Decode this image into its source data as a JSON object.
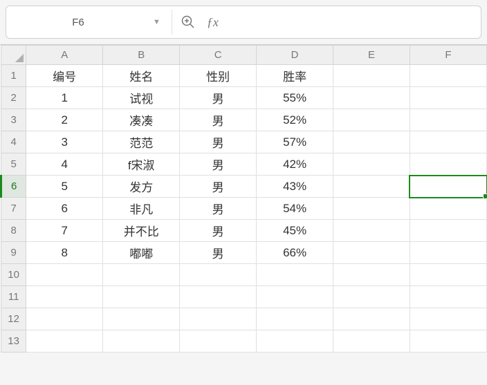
{
  "formula_bar": {
    "cell_reference": "F6",
    "formula_value": ""
  },
  "columns": [
    "A",
    "B",
    "C",
    "D",
    "E",
    "F"
  ],
  "row_numbers": [
    "1",
    "2",
    "3",
    "4",
    "5",
    "6",
    "7",
    "8",
    "9",
    "10",
    "11",
    "12",
    "13"
  ],
  "active_row": 6,
  "selected_cell": {
    "row": 6,
    "col": "F"
  },
  "chart_data": {
    "type": "table",
    "headers": [
      "编号",
      "姓名",
      "性别",
      "胜率"
    ],
    "rows": [
      [
        "1",
        "试视",
        "男",
        "55%"
      ],
      [
        "2",
        "凑凑",
        "男",
        "52%"
      ],
      [
        "3",
        "范范",
        "男",
        "57%"
      ],
      [
        "4",
        "f宋淑",
        "男",
        "42%"
      ],
      [
        "5",
        "发方",
        "男",
        "43%"
      ],
      [
        "6",
        "非凡",
        "男",
        "54%"
      ],
      [
        "7",
        "并不比",
        "男",
        "45%"
      ],
      [
        "8",
        "嘟嘟",
        "男",
        "66%"
      ]
    ]
  }
}
